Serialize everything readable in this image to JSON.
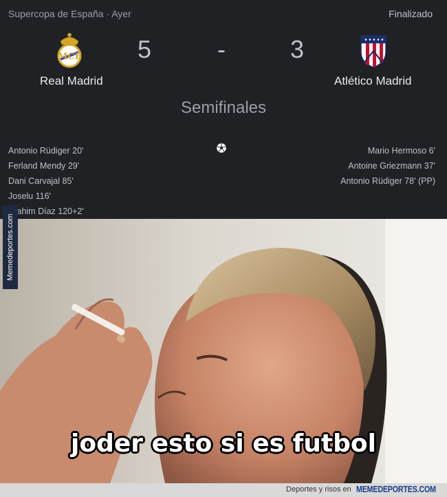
{
  "match": {
    "competition": "Supercopa de España · Ayer",
    "status": "Finalizado",
    "round": "Semifinales",
    "home": {
      "name": "Real Madrid",
      "score": "5",
      "crest_icon": "real-madrid-crest-icon",
      "scorers": [
        "Antonio Rüdiger 20'",
        "Ferland Mendy 29'",
        "Dani Carvajal 85'",
        "Joselu 116'",
        "Brahim Díaz 120+2'"
      ]
    },
    "separator": "-",
    "away": {
      "name": "Atlético Madrid",
      "score": "3",
      "crest_icon": "atletico-madrid-crest-icon",
      "scorers": [
        "Mario Hermoso 6'",
        "Antoine Griezmann 37'",
        "Antonio Rüdiger 78' (PP)"
      ]
    },
    "goals_icon": "soccer-ball-icon"
  },
  "meme": {
    "caption": "joder esto si es futbol",
    "side_watermark": "Memedeportes.com"
  },
  "footer": {
    "text": "Deportes y risos en",
    "brand": "MEMEDEPORTES.COM"
  },
  "colors": {
    "card_background": "#202124",
    "primary_text": "#e8eaed",
    "secondary_text": "#9aa0a6",
    "real_madrid_gold": "#d4a62a",
    "atletico_red": "#c8102e",
    "atletico_blue": "#1b2e6b",
    "brand_blue": "#1a3f8a"
  }
}
